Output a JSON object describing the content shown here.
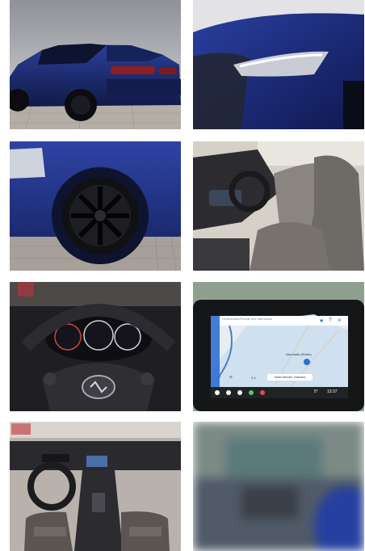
{
  "gallery": {
    "photos": [
      {
        "id": "rear-three-quarter"
      },
      {
        "id": "headlight-closeup"
      },
      {
        "id": "wheel-closeup"
      },
      {
        "id": "interior-front-seats"
      },
      {
        "id": "steering-wheel-cluster"
      },
      {
        "id": "infotainment-navigation"
      },
      {
        "id": "dashboard-overview"
      },
      {
        "id": "blurred-detail"
      }
    ]
  },
  "navigation_screen": {
    "search_placeholder": "Ort/Adresse/Punkte des Interesses",
    "poi_label": "Neumarkt (Rhein)",
    "distance": "3.4",
    "street_label": "Sankt Wendel, Saarland",
    "temperature": "5°",
    "clock": "13:37"
  },
  "colors": {
    "car_paint": "#1e2f7a",
    "nav_accent": "#2f6fd6"
  }
}
